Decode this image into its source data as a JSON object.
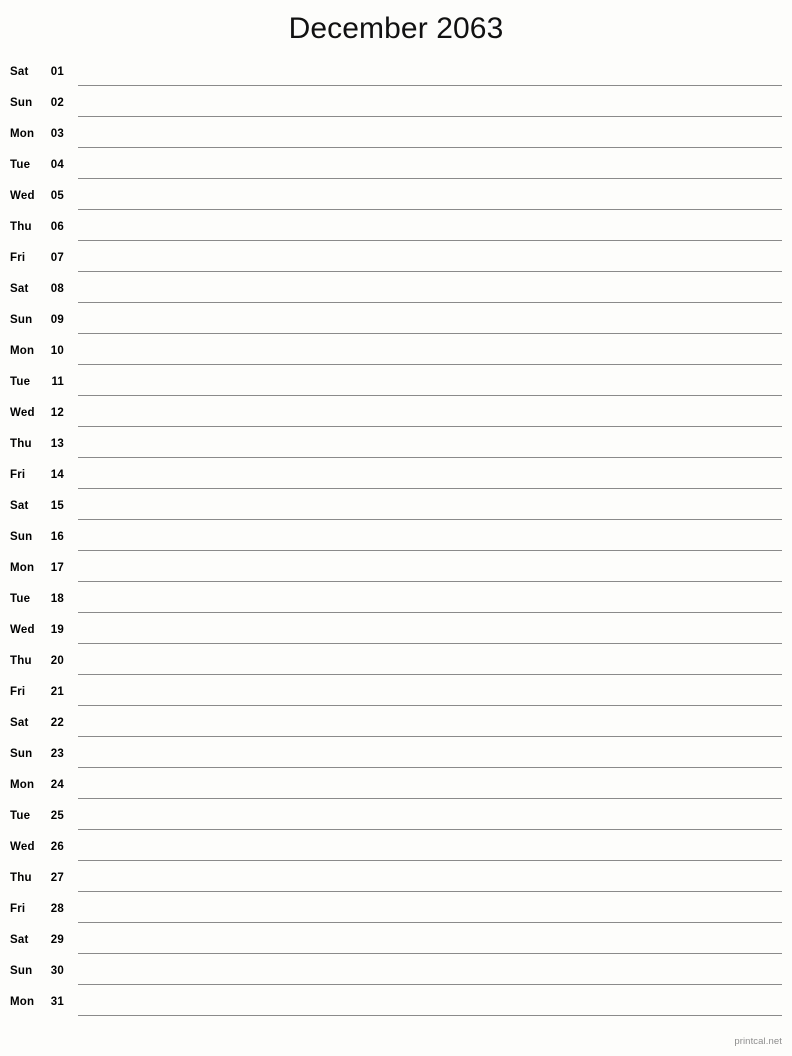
{
  "document": {
    "type": "printable-calendar",
    "layout": "single-column-notes",
    "title": "December 2063",
    "month": "December",
    "year": "2063"
  },
  "colors": {
    "background": "#fdfdfb",
    "text": "#000000",
    "title": "#111111",
    "rule": "#8a8a8a",
    "footer": "#8d8d8d"
  },
  "footer": {
    "brand": "printcal.net"
  },
  "days": [
    {
      "dow": "Sat",
      "date": "01"
    },
    {
      "dow": "Sun",
      "date": "02"
    },
    {
      "dow": "Mon",
      "date": "03"
    },
    {
      "dow": "Tue",
      "date": "04"
    },
    {
      "dow": "Wed",
      "date": "05"
    },
    {
      "dow": "Thu",
      "date": "06"
    },
    {
      "dow": "Fri",
      "date": "07"
    },
    {
      "dow": "Sat",
      "date": "08"
    },
    {
      "dow": "Sun",
      "date": "09"
    },
    {
      "dow": "Mon",
      "date": "10"
    },
    {
      "dow": "Tue",
      "date": "11"
    },
    {
      "dow": "Wed",
      "date": "12"
    },
    {
      "dow": "Thu",
      "date": "13"
    },
    {
      "dow": "Fri",
      "date": "14"
    },
    {
      "dow": "Sat",
      "date": "15"
    },
    {
      "dow": "Sun",
      "date": "16"
    },
    {
      "dow": "Mon",
      "date": "17"
    },
    {
      "dow": "Tue",
      "date": "18"
    },
    {
      "dow": "Wed",
      "date": "19"
    },
    {
      "dow": "Thu",
      "date": "20"
    },
    {
      "dow": "Fri",
      "date": "21"
    },
    {
      "dow": "Sat",
      "date": "22"
    },
    {
      "dow": "Sun",
      "date": "23"
    },
    {
      "dow": "Mon",
      "date": "24"
    },
    {
      "dow": "Tue",
      "date": "25"
    },
    {
      "dow": "Wed",
      "date": "26"
    },
    {
      "dow": "Thu",
      "date": "27"
    },
    {
      "dow": "Fri",
      "date": "28"
    },
    {
      "dow": "Sat",
      "date": "29"
    },
    {
      "dow": "Sun",
      "date": "30"
    },
    {
      "dow": "Mon",
      "date": "31"
    }
  ]
}
